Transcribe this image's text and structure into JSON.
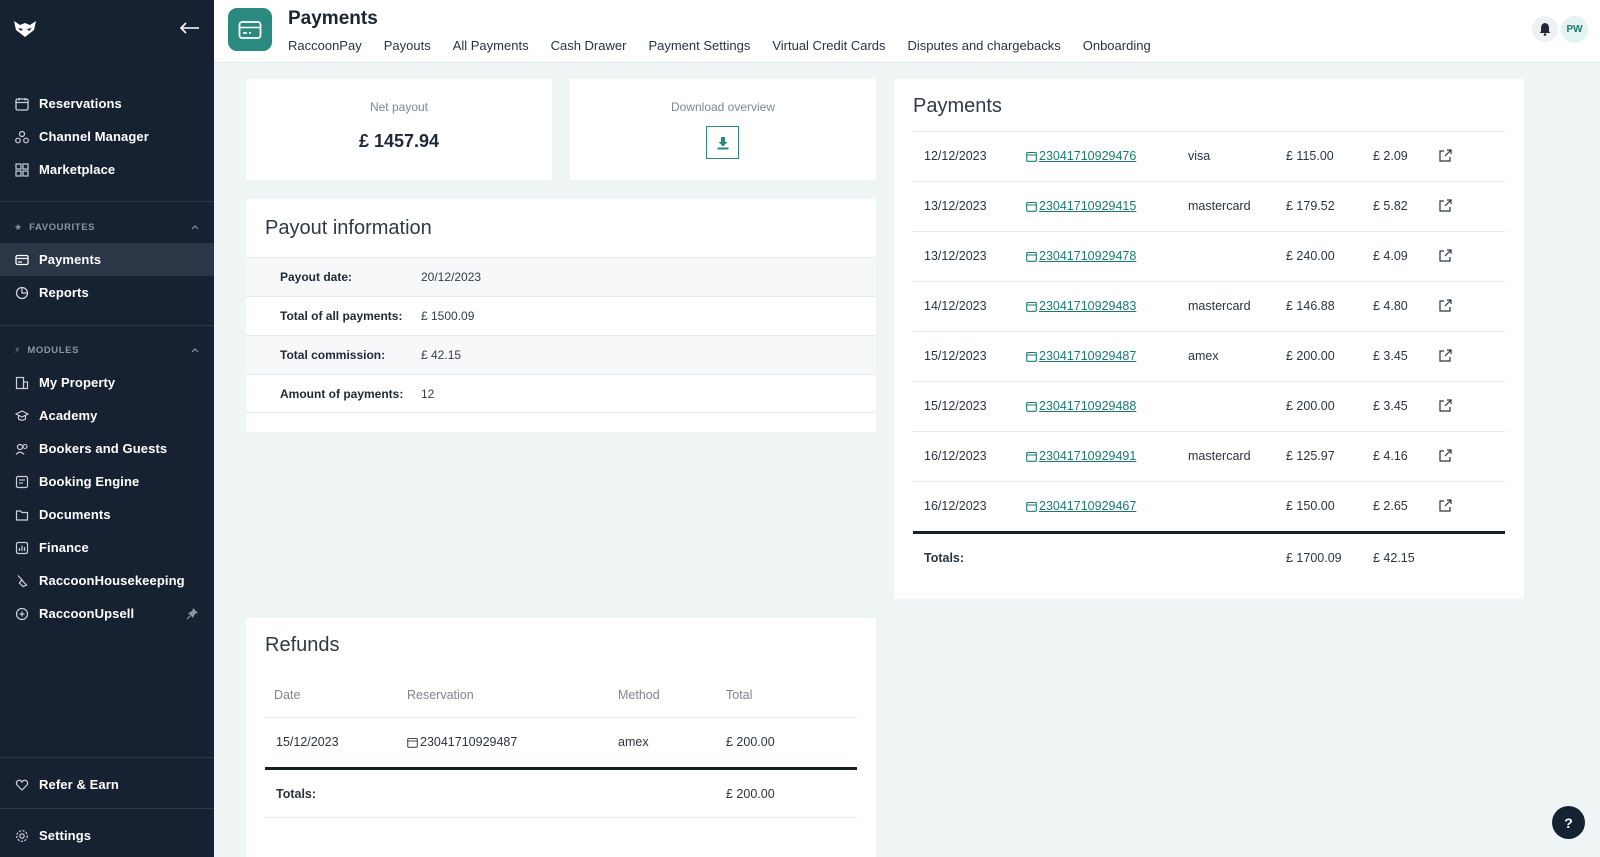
{
  "sidebar": {
    "main_items": [
      {
        "label": "Reservations",
        "icon": "calendar-icon"
      },
      {
        "label": "Channel Manager",
        "icon": "channel-manager-icon"
      },
      {
        "label": "Marketplace",
        "icon": "marketplace-icon"
      }
    ],
    "favourites_title": "FAVOURITES",
    "favourites": [
      {
        "label": "Payments",
        "icon": "payment-card-icon",
        "active": true
      },
      {
        "label": "Reports",
        "icon": "pie-chart-icon"
      }
    ],
    "modules_title": "MODULES",
    "modules": [
      {
        "label": "My Property",
        "icon": "building-icon"
      },
      {
        "label": "Academy",
        "icon": "graduation-cap-icon"
      },
      {
        "label": "Bookers and Guests",
        "icon": "users-icon"
      },
      {
        "label": "Booking Engine",
        "icon": "booking-engine-icon"
      },
      {
        "label": "Documents",
        "icon": "folder-icon"
      },
      {
        "label": "Finance",
        "icon": "bar-chart-icon"
      },
      {
        "label": "RaccoonHousekeeping",
        "icon": "broom-icon"
      },
      {
        "label": "RaccoonUpsell",
        "icon": "plus-circle-icon"
      }
    ],
    "bottom": [
      {
        "label": "Refer & Earn",
        "icon": "heart-icon"
      },
      {
        "label": "Settings",
        "icon": "gear-icon"
      }
    ]
  },
  "header": {
    "title": "Payments",
    "tabs": [
      "RaccoonPay",
      "Payouts",
      "All Payments",
      "Cash Drawer",
      "Payment Settings",
      "Virtual Credit Cards",
      "Disputes and chargebacks",
      "Onboarding"
    ],
    "avatar_initials": "PW"
  },
  "net_payout": {
    "label": "Net payout",
    "value": "£ 1457.94"
  },
  "download": {
    "label": "Download overview"
  },
  "payout_info": {
    "title": "Payout information",
    "rows": [
      {
        "key": "Payout date:",
        "value": "20/12/2023"
      },
      {
        "key": "Total of all payments:",
        "value": "£ 1500.09"
      },
      {
        "key": "Total commission:",
        "value": "£ 42.15"
      },
      {
        "key": "Amount of payments:",
        "value": "12"
      }
    ]
  },
  "payments": {
    "title": "Payments",
    "rows": [
      {
        "date": "12/12/2023",
        "reservation": "23041710929476",
        "method": "visa",
        "total": "£ 115.00",
        "commission": "£ 2.09"
      },
      {
        "date": "13/12/2023",
        "reservation": "23041710929415",
        "method": "mastercard",
        "total": "£ 179.52",
        "commission": "£ 5.82"
      },
      {
        "date": "13/12/2023",
        "reservation": "23041710929478",
        "method": "",
        "total": "£ 240.00",
        "commission": "£ 4.09"
      },
      {
        "date": "14/12/2023",
        "reservation": "23041710929483",
        "method": "mastercard",
        "total": "£ 146.88",
        "commission": "£ 4.80"
      },
      {
        "date": "15/12/2023",
        "reservation": "23041710929487",
        "method": "amex",
        "total": "£ 200.00",
        "commission": "£ 3.45"
      },
      {
        "date": "15/12/2023",
        "reservation": "23041710929488",
        "method": "",
        "total": "£ 200.00",
        "commission": "£ 3.45"
      },
      {
        "date": "16/12/2023",
        "reservation": "23041710929491",
        "method": "mastercard",
        "total": "£ 125.97",
        "commission": "£ 4.16"
      },
      {
        "date": "16/12/2023",
        "reservation": "23041710929467",
        "method": "",
        "total": "£ 150.00",
        "commission": "£ 2.65"
      }
    ],
    "totals_label": "Totals:",
    "totals_total": "£ 1700.09",
    "totals_commission": "£ 42.15"
  },
  "refunds": {
    "title": "Refunds",
    "headers": [
      "Date",
      "Reservation",
      "Method",
      "Total"
    ],
    "rows": [
      {
        "date": "15/12/2023",
        "reservation": "23041710929487",
        "method": "amex",
        "total": "£ 200.00"
      }
    ],
    "totals_label": "Totals:",
    "totals_total": "£ 200.00"
  },
  "help_label": "?",
  "colors": {
    "sidebar_bg": "#162231",
    "accent": "#2a8a7f",
    "page_bg": "#eff4f4"
  }
}
